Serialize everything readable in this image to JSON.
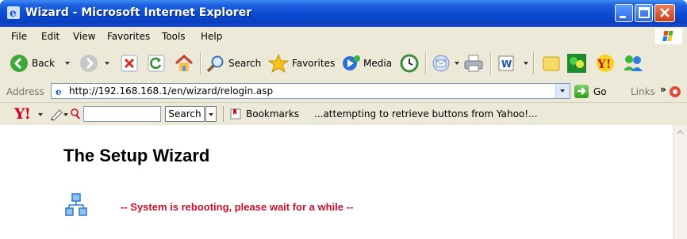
{
  "window": {
    "title": "Wizard - Microsoft Internet Explorer"
  },
  "menu": {
    "items": [
      "File",
      "Edit",
      "View",
      "Favorites",
      "Tools",
      "Help"
    ]
  },
  "toolbar": {
    "back_label": "Back",
    "search_label": "Search",
    "favorites_label": "Favorites",
    "media_label": "Media"
  },
  "address": {
    "label": "Address",
    "url": "http://192.168.168.1/en/wizard/relogin.asp",
    "go_label": "Go",
    "links_label": "Links"
  },
  "yahoo": {
    "logo_text": "Y!",
    "search_input_value": "",
    "search_button_label": "Search",
    "bookmarks_label": "Bookmarks",
    "status_text": "...attempting to retrieve buttons from Yahoo!..."
  },
  "page": {
    "title": "The Setup Wizard",
    "status_message": "-- System is rebooting, please wait for a while --",
    "status_color": "#c8102e"
  },
  "icons": [
    "ie-logo-icon",
    "minimize-icon",
    "maximize-icon",
    "close-icon",
    "windows-flag-icon",
    "back-icon",
    "forward-icon",
    "stop-icon",
    "refresh-icon",
    "home-icon",
    "search-icon",
    "favorites-star-icon",
    "media-icon",
    "history-icon",
    "mail-icon",
    "print-icon",
    "word-icon",
    "folder-icon",
    "messenger-icon",
    "network-icon"
  ]
}
